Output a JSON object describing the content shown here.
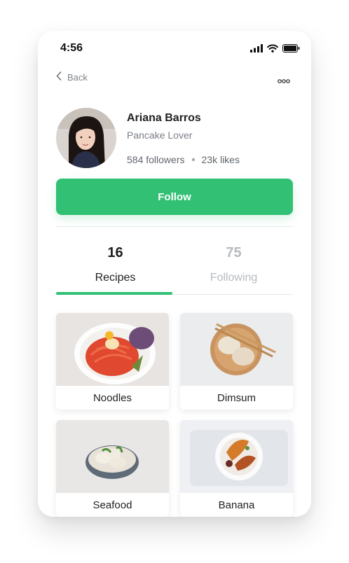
{
  "status": {
    "time": "4:56",
    "icons": [
      "signal-icon",
      "wifi-icon",
      "battery-icon"
    ]
  },
  "nav": {
    "back_label": "Back",
    "back_icon": "chevron-left-icon",
    "more_icon": "more-horizontal-icon"
  },
  "profile": {
    "name": "Ariana Barros",
    "tagline": "Pancake Lover",
    "followers": "584 followers",
    "likes": "23k likes"
  },
  "follow_label": "Follow",
  "colors": {
    "accent": "#32c074",
    "text": "#222222",
    "muted": "#b6babf"
  },
  "tabs": [
    {
      "count": "16",
      "label": "Recipes",
      "active": true
    },
    {
      "count": "75",
      "label": "Following",
      "active": false
    }
  ],
  "recipes": [
    {
      "label": "Noodles",
      "image": "noodles-photo"
    },
    {
      "label": "Dimsum",
      "image": "dimsum-photo"
    },
    {
      "label": "Seafood",
      "image": "seafood-photo"
    },
    {
      "label": "Banana",
      "image": "banana-photo"
    }
  ]
}
